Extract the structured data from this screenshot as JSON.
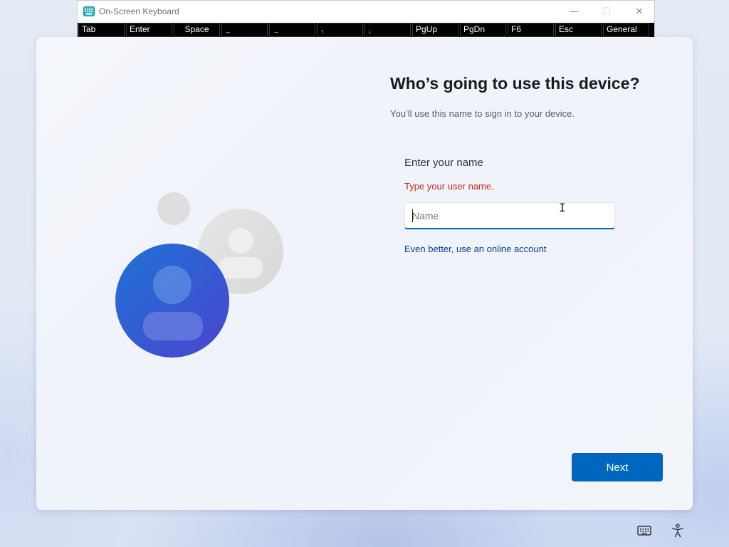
{
  "osk": {
    "title": "On-Screen Keyboard",
    "controls": {
      "minimize": "—",
      "maximize": "☐",
      "close": "✕"
    },
    "keys": [
      "Tab",
      "Enter",
      "Space",
      "←",
      "→",
      "↑",
      "↓",
      "PgUp",
      "PgDn",
      "F6",
      "Esc",
      "General"
    ]
  },
  "page": {
    "heading": "Who’s going to use this device?",
    "subheading": "You’ll use this name to sign in to your device.",
    "field_label": "Enter your name",
    "error": "Type your user name.",
    "input": {
      "value": "",
      "placeholder": "Name"
    },
    "online_link": "Even better, use an online account",
    "next_label": "Next"
  },
  "icons": {
    "osk_app": "keyboard-app-icon",
    "illustration": "users-illustration",
    "tray_keyboard": "keyboard-icon",
    "tray_accessibility": "accessibility-icon"
  },
  "colors": {
    "accent": "#0067c0",
    "error": "#c42b1c",
    "link": "#003e92"
  }
}
